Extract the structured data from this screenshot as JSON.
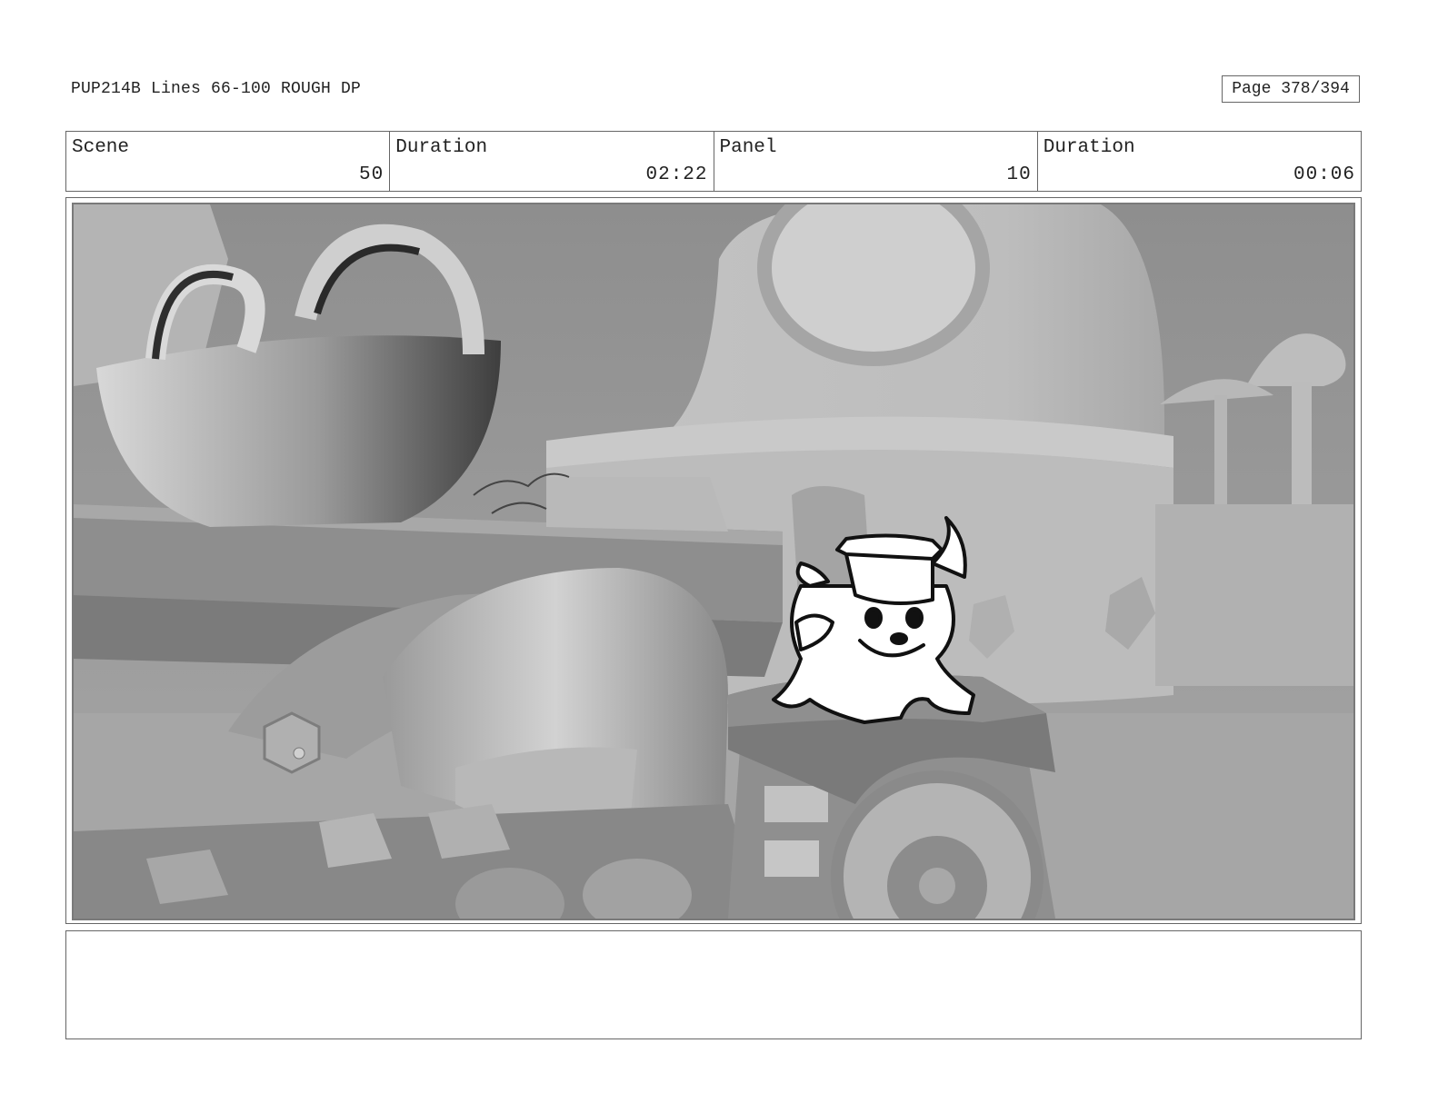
{
  "header": {
    "title": "PUP214B Lines 66-100 ROUGH DP",
    "page": "Page 378/394"
  },
  "info": {
    "scene_label": "Scene",
    "scene_value": "50",
    "scene_duration_label": "Duration",
    "scene_duration_value": "02:22",
    "panel_label": "Panel",
    "panel_value": "10",
    "panel_duration_label": "Duration",
    "panel_duration_value": "00:06"
  },
  "notes": {
    "text": ""
  }
}
